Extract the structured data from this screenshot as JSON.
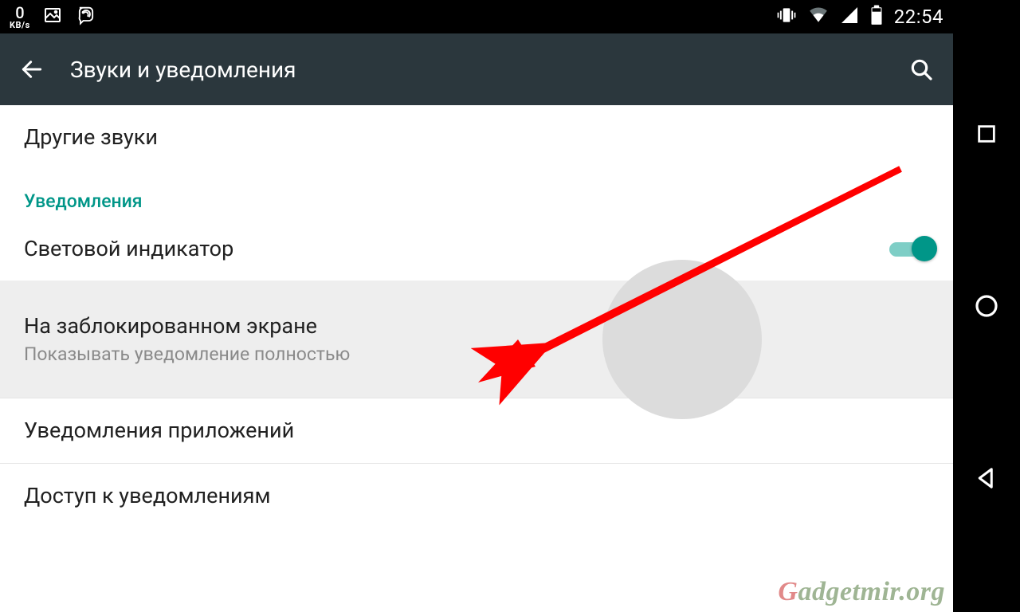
{
  "status_bar": {
    "kbs_value": "0",
    "kbs_label": "KB/s",
    "time": "22:54"
  },
  "app_bar": {
    "title": "Звуки и уведомления"
  },
  "list": {
    "other_sounds": "Другие звуки",
    "section_notifications": "Уведомления",
    "pulse_light": "Световой индикатор",
    "lock_screen_title": "На заблокированном экране",
    "lock_screen_sub": "Показывать уведомление полностью",
    "app_notifications": "Уведомления приложений",
    "notification_access": "Доступ к уведомлениям"
  },
  "watermark": {
    "g": "G",
    "rest": "adgetmir.org"
  }
}
